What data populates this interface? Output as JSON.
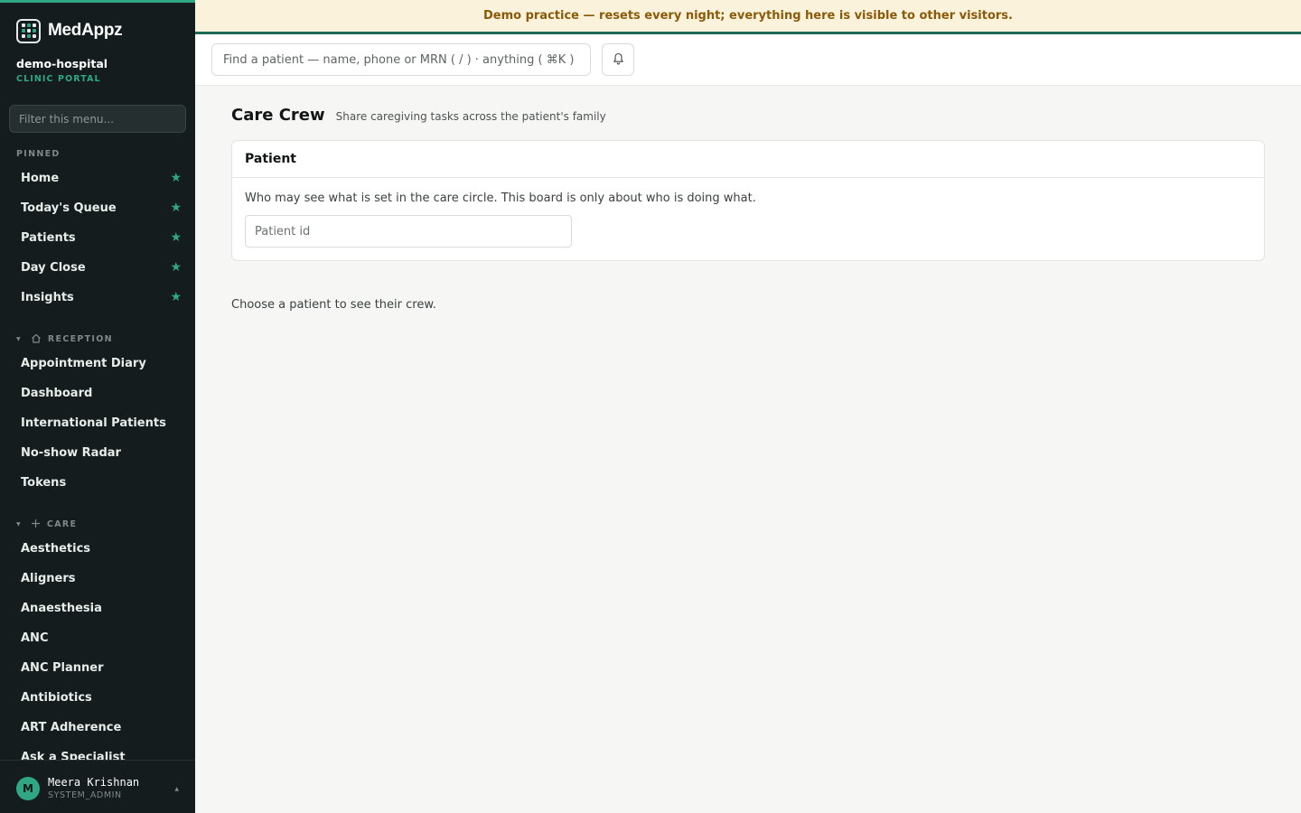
{
  "app": {
    "name": "MedAppz"
  },
  "tenant": {
    "name": "demo-hospital",
    "portal": "CLINIC PORTAL"
  },
  "sidebar": {
    "filter_placeholder": "Filter this menu...",
    "pinned_label": "PINNED",
    "pinned": [
      {
        "label": "Home"
      },
      {
        "label": "Today's Queue"
      },
      {
        "label": "Patients"
      },
      {
        "label": "Day Close"
      },
      {
        "label": "Insights"
      }
    ],
    "star_glyph": "★",
    "reception_label": "RECEPTION",
    "reception": [
      {
        "label": "Appointment Diary"
      },
      {
        "label": "Dashboard"
      },
      {
        "label": "International Patients"
      },
      {
        "label": "No-show Radar"
      },
      {
        "label": "Tokens"
      }
    ],
    "care_label": "CARE",
    "care": [
      {
        "label": "Aesthetics"
      },
      {
        "label": "Aligners"
      },
      {
        "label": "Anaesthesia"
      },
      {
        "label": "ANC"
      },
      {
        "label": "ANC Planner"
      },
      {
        "label": "Antibiotics"
      },
      {
        "label": "ART Adherence"
      },
      {
        "label": "Ask a Specialist"
      }
    ]
  },
  "user": {
    "initial": "M",
    "name": "Meera Krishnan",
    "role": "SYSTEM_ADMIN"
  },
  "banner": {
    "text": "Demo practice — resets every night; everything here is visible to other visitors."
  },
  "topbar": {
    "search_placeholder": "Find a patient — name, phone or MRN ( / ) · anything ( ⌘K )"
  },
  "page": {
    "title": "Care Crew",
    "subtitle": "Share caregiving tasks across the patient's family",
    "card_title": "Patient",
    "card_text": "Who may see what is set in the care circle. This board is only about who is doing what.",
    "patient_placeholder": "Patient id",
    "empty_text": "Choose a patient to see their crew."
  },
  "colors": {
    "accent": "#2fa784",
    "sidebar_bg": "#141c1d",
    "banner_bg": "#fbf2dc",
    "banner_text": "#8a5a08"
  }
}
